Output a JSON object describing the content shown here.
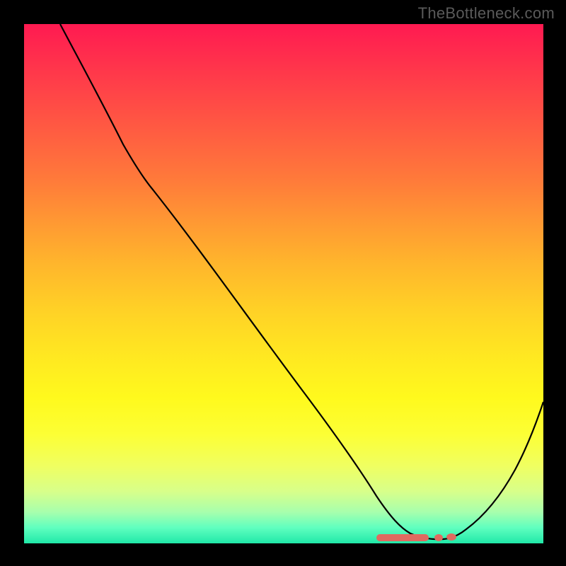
{
  "watermark": "TheBottleneck.com",
  "chart_data": {
    "type": "line",
    "title": "",
    "xlabel": "",
    "ylabel": "",
    "xlim": [
      0,
      100
    ],
    "ylim": [
      0,
      100
    ],
    "series": [
      {
        "name": "curve",
        "x": [
          7,
          12,
          18,
          22,
          26,
          30,
          35,
          40,
          45,
          50,
          55,
          60,
          63,
          66,
          68,
          70,
          73,
          76,
          80,
          84,
          88,
          92,
          96,
          100
        ],
        "values": [
          100,
          91,
          81,
          75,
          70,
          65,
          58,
          51,
          45,
          38,
          31,
          24,
          18,
          12,
          8,
          5,
          2.5,
          1.2,
          0.9,
          1.0,
          2.5,
          8,
          16,
          27
        ]
      },
      {
        "name": "points",
        "x": [
          68,
          70,
          72,
          74,
          76,
          78,
          80,
          82,
          84
        ],
        "values": [
          1.2,
          1.1,
          1.0,
          1.0,
          1.0,
          1.1,
          1.15,
          1.2,
          1.3
        ]
      }
    ]
  }
}
